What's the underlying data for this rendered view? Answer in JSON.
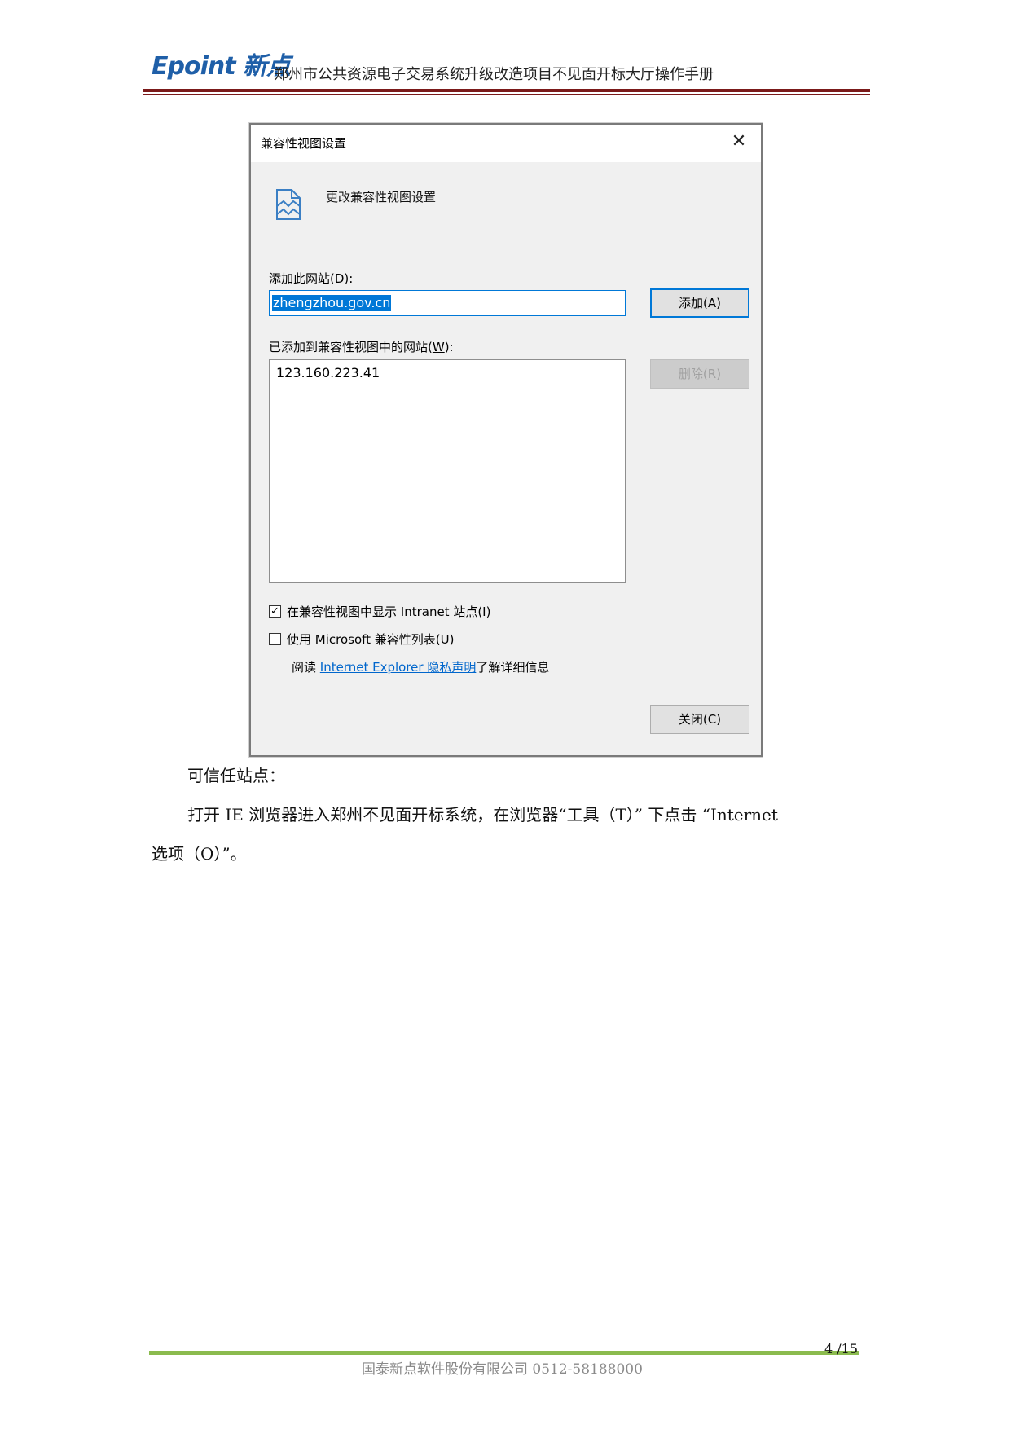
{
  "header": {
    "logo": "Epoint 新点",
    "doc_title": "郑州市公共资源电子交易系统升级改造项目不见面开标大厅操作手册"
  },
  "dialog": {
    "window_title": "兼容性视图设置",
    "heading": "更改兼容性视图设置",
    "add_site_label": "添加此网站(",
    "add_site_key": "D",
    "add_site_suffix": "):",
    "site_input_value": "zhengzhou.gov.cn",
    "add_button": "添加(A)",
    "added_sites_label": "已添加到兼容性视图中的网站(",
    "added_sites_key": "W",
    "added_sites_suffix": "):",
    "added_sites": [
      "123.160.223.41"
    ],
    "remove_button": "删除(R)",
    "intranet_checked": true,
    "intranet_label": "在兼容性视图中显示 Intranet 站点(I)",
    "ms_list_checked": false,
    "ms_list_label": "使用 Microsoft 兼容性列表(U)",
    "read_prefix": "阅读",
    "privacy_link": "Internet Explorer 隐私声明",
    "read_suffix": "了解详细信息",
    "close_button": "关闭(C)"
  },
  "body": {
    "heading": "可信任站点：",
    "para_line1": "打开 IE 浏览器进入郑州不见面开标系统，在浏览器“工具（T）” 下点击 “Internet",
    "para_line2": "选项（O）”。"
  },
  "footer": {
    "page": "4 /15",
    "company": "国泰新点软件股份有限公司 0512-58188000"
  },
  "colors": {
    "logo": "#1f5fa8",
    "header_rule": "#7b1a1a",
    "footer_rule": "#8bbb4e",
    "selection": "#0078d7",
    "link": "#0066cc"
  }
}
